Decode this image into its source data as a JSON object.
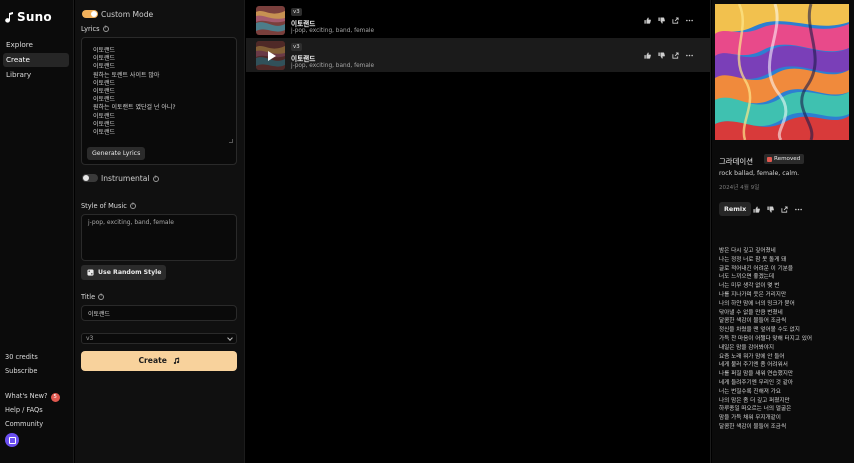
{
  "app": {
    "name": "Suno"
  },
  "nav": {
    "items": [
      {
        "label": "Explore",
        "active": false
      },
      {
        "label": "Create",
        "active": true
      },
      {
        "label": "Library",
        "active": false
      }
    ],
    "credits": "30 credits",
    "subscribe": "Subscribe",
    "whats_new": "What's New?",
    "whats_new_count": "5",
    "help": "Help / FAQs",
    "community": "Community"
  },
  "create": {
    "custom_mode_label": "Custom Mode",
    "custom_mode_on": true,
    "lyrics_label": "Lyrics",
    "lyrics_lines": [
      "이토랜드",
      "이토랜드",
      "이토랜드",
      "원하는 토렌트 사이트 많아",
      "이토랜드",
      "이토랜드",
      "이토랜드",
      "원하는 이토랜트 였단걸 넌 아니?",
      "이토랜드",
      "이토랜드",
      "이토랜드"
    ],
    "generate_lyrics_label": "Generate Lyrics",
    "instrumental_label": "Instrumental",
    "instrumental_on": false,
    "style_label": "Style of Music",
    "style_value": "j-pop, exciting, band, female",
    "random_style_label": "Use Random Style",
    "title_label": "Title",
    "title_value": "이토랜드",
    "version_value": "v3",
    "create_label": "Create"
  },
  "songs": [
    {
      "version": "v3",
      "title": "이토랜드",
      "tags": "j-pop, exciting, band, female",
      "selected": false
    },
    {
      "version": "v3",
      "title": "이토랜드",
      "tags": "j-pop, exciting, band, female",
      "selected": true
    }
  ],
  "detail": {
    "title": "그라데이션",
    "status": "Removed",
    "tags": "rock ballad, female, calm.",
    "date": "2024년 4월 9일",
    "remix_label": "Remix",
    "lyrics": [
      "밤은 다시 깊고 깊어졌네",
      "나는 정정 너로 참 못 돌게 돼",
      "글로 적어내긴 어려운 이 기분을",
      "너도 느끼으면 좋겠는데",
      "너는 미무 생각 없이 몇 번",
      "나를 지나가며 웃은 거리지만",
      "나의 하얀 맘에 너의 밍크가 묻어",
      "닦아낼 수 없을 만큼 번졌네",
      "달콤한 색감이 물들어 조금씩",
      "정신을 차렸을 땐 엎어볼 수도 없지",
      "가득 찬 마음이 어쩔다 맞해 터지고 있어",
      "내일은 맘을 감어봐야지",
      "요즘 노래 뭐가 맘에 안 들어",
      "네게 불러 주기엔 좀 어려워서",
      "나를 퍼질 맘을 새워 연습했지만",
      "네게 들려주기엔 무리인 것 같아",
      "너는 번질수록 진해져 가요",
      "나의 맘은 좀 더 깊고 퍼졌지만",
      "하루종일 떠오르는 너의 얼굴은",
      "맘을 가득 채워 무지개같이",
      "달콤한 색감이 물들어 조금씩"
    ]
  },
  "colors": {
    "accent": "#f8d29c",
    "toggle_on": "#f2b15b",
    "removed_icon": "#e0584f"
  }
}
